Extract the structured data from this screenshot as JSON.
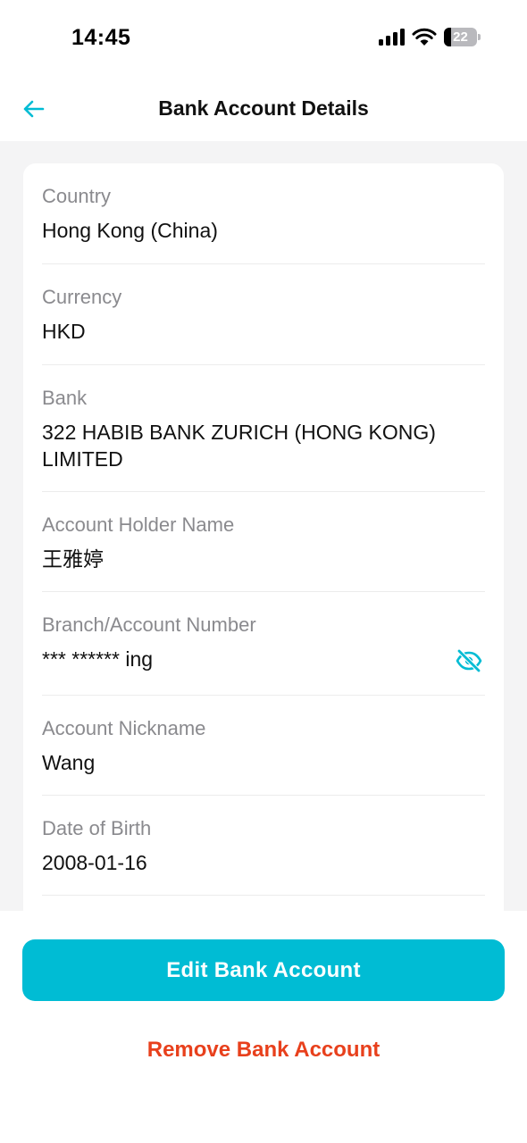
{
  "status_bar": {
    "time": "14:45",
    "battery_level": "22"
  },
  "header": {
    "title": "Bank Account Details",
    "back_icon": "arrow-left-icon"
  },
  "details": {
    "country": {
      "label": "Country",
      "value": "Hong Kong (China)"
    },
    "currency": {
      "label": "Currency",
      "value": "HKD"
    },
    "bank": {
      "label": "Bank",
      "value": "322 HABIB BANK ZURICH (HONG KONG) LIMITED"
    },
    "account_holder": {
      "label": "Account Holder Name",
      "value": "王雅婷"
    },
    "branch_account": {
      "label": "Branch/Account Number",
      "value": "*** ****** ing",
      "toggle_icon": "eye-off-icon"
    },
    "nickname": {
      "label": "Account Nickname",
      "value": "Wang"
    },
    "date_of_birth": {
      "label": "Date of Birth",
      "value": "2008-01-16"
    }
  },
  "actions": {
    "edit_label": "Edit Bank Account",
    "remove_label": "Remove Bank Account"
  },
  "colors": {
    "accent": "#00bcd4",
    "danger": "#e8401c",
    "label_gray": "#8a8a8e",
    "background": "#f4f4f5"
  }
}
